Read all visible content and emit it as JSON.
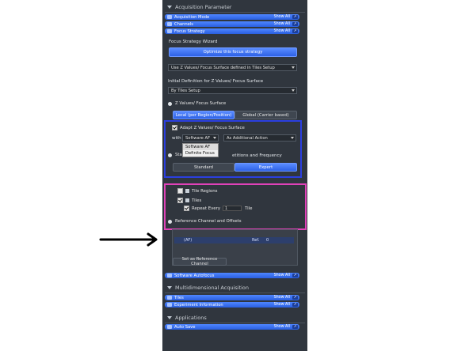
{
  "sections": {
    "acquisition": "Acquisition Parameter",
    "multidim": "Multidimensional Acquisition",
    "applications": "Applications"
  },
  "tools": [
    {
      "label": "Acquisition Mode",
      "show": "Show All"
    },
    {
      "label": "Channels",
      "show": "Show All"
    },
    {
      "label": "Focus Strategy",
      "show": "Show All"
    }
  ],
  "focus": {
    "wizard_label": "Focus Strategy Wizard",
    "optimize_btn": "Optimize this focus strategy",
    "strategy_value": "Use Z Values/ Focus Surface defined in Tiles Setup",
    "initial_label": "Initial Definition for Z Values/ Focus Surface",
    "initial_value": "By Tiles Setup",
    "zvalues_label": "Z Values/ Focus Surface",
    "tab_local": "Local (per Region/Position)",
    "tab_global": "Global (Carrier based)",
    "adapt_label": "Adapt Z Values/ Focus Surface",
    "with_label": "with",
    "with_value": "Software AF",
    "action_value": "As Additional Action",
    "menu_items": [
      "Software AF",
      "Definite Focus"
    ],
    "stab_prefix": "Stab",
    "stab_suffix": "etitions and Frequency",
    "mode_standard": "Standard",
    "mode_expert": "Expert",
    "tile_regions": "Tile Regions",
    "tiles": "Tiles",
    "repeat_label": "Repeat Every",
    "repeat_value": "1",
    "tile_unit": "Tile",
    "ref_label": "Reference Channel and Offsets",
    "ref_row_channel": "(AF)",
    "ref_row_ref": "Ref.",
    "ref_row_val": "0",
    "set_ref_btn": "Set as Reference Channel"
  },
  "tools2": [
    {
      "label": "Software Autofocus",
      "show": "Show All"
    },
    {
      "label": "Tiles",
      "show": "Show All"
    },
    {
      "label": "Experiment Information",
      "show": "Show All"
    },
    {
      "label": "Auto Save",
      "show": "Show All"
    }
  ],
  "colors": {
    "blue_highlight": "#2b3fe0",
    "pink_highlight": "#e042b8",
    "accent": "#3a6ff0",
    "panel_bg": "#30363e"
  }
}
